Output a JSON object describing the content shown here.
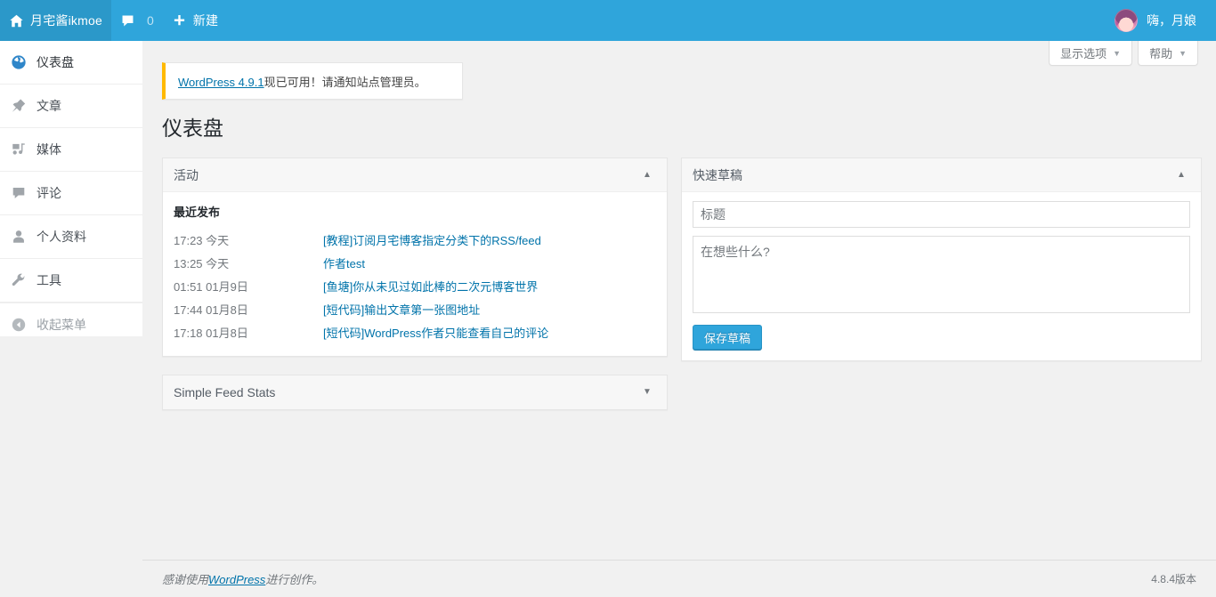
{
  "adminbar": {
    "site_name": "月宅酱ikmoe",
    "site_icon": "home-icon",
    "comments_icon": "comment-bubble-icon",
    "comments_count": "0",
    "new_icon": "plus-icon",
    "new_label": "新建",
    "greeting": "嗨，月娘",
    "avatar_name": "avatar",
    "bar_color": "#2fa5db"
  },
  "sidebar": {
    "items": [
      {
        "label": "仪表盘",
        "icon": "dashboard-gauge-icon",
        "current": true,
        "name": "sidebar-item-dashboard"
      },
      {
        "label": "文章",
        "icon": "pin-icon",
        "current": false,
        "name": "sidebar-item-posts"
      },
      {
        "label": "媒体",
        "icon": "media-icon",
        "current": false,
        "name": "sidebar-item-media"
      },
      {
        "label": "评论",
        "icon": "comment-bubble-icon",
        "current": false,
        "name": "sidebar-item-comments"
      },
      {
        "label": "个人资料",
        "icon": "user-icon",
        "current": false,
        "name": "sidebar-item-profile"
      },
      {
        "label": "工具",
        "icon": "wrench-icon",
        "current": false,
        "name": "sidebar-item-tools"
      }
    ],
    "collapse": {
      "label": "收起菜单",
      "icon": "collapse-left-arrow-icon"
    }
  },
  "screen_meta": {
    "screen_options_label": "显示选项",
    "help_label": "帮助",
    "arrow": "▼"
  },
  "notice": {
    "link_text": "WordPress 4.9.1",
    "rest_text": "现已可用！请通知站点管理员。",
    "accent_color": "#ffb900"
  },
  "page": {
    "title": "仪表盘"
  },
  "activity": {
    "title": "活动",
    "toggle_icon": "chevron-up-icon",
    "subtitle": "最近发布",
    "rows": [
      {
        "time": "17:23 今天",
        "title": "[教程]订阅月宅博客指定分类下的RSS/feed"
      },
      {
        "time": "13:25 今天",
        "title": "作者test"
      },
      {
        "time": "01:51 01月9日",
        "title": "[鱼塘]你从未见过如此棒的二次元博客世界"
      },
      {
        "time": "17:44 01月8日",
        "title": "[短代码]输出文章第一张图地址"
      },
      {
        "time": "17:18 01月8日",
        "title": "[短代码]WordPress作者只能查看自己的评论"
      }
    ]
  },
  "feed_stats": {
    "title": "Simple Feed Stats",
    "toggle_icon": "chevron-down-icon"
  },
  "quick_draft": {
    "title": "快速草稿",
    "toggle_icon": "chevron-up-icon",
    "title_placeholder": "标题",
    "title_value": "",
    "content_placeholder": "在想些什么?",
    "content_value": "",
    "save_label": "保存草稿"
  },
  "footer": {
    "thanks_prefix": "感谢使用",
    "wordpress_link": "WordPress",
    "thanks_suffix": "进行创作。",
    "version": "4.8.4版本"
  }
}
